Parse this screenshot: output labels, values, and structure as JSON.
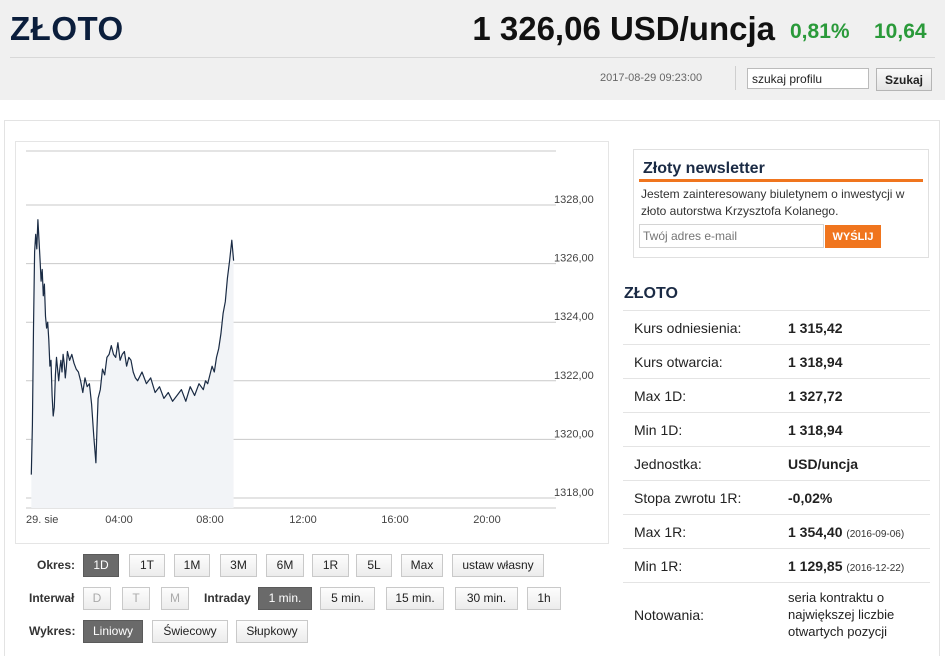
{
  "header": {
    "title": "ZŁOTO",
    "price": "1 326,06 USD/uncja",
    "change_pct": "0,81%",
    "change_abs": "10,64",
    "timestamp": "2017-08-29 09:23:00",
    "search_value": "szukaj profilu",
    "search_button": "Szukaj",
    "accent_color": "#2a9a3a"
  },
  "chart_data": {
    "type": "line",
    "title": "",
    "xlabel": "",
    "ylabel": "",
    "x_ticks": [
      "29. sie",
      "04:00",
      "08:00",
      "12:00",
      "16:00",
      "20:00"
    ],
    "y_ticks": [
      "1328,00",
      "1326,00",
      "1324,00",
      "1322,00",
      "1320,00",
      "1318,00"
    ],
    "ylim": [
      1318,
      1328
    ],
    "x_hours": [
      0.15,
      0.2,
      0.25,
      0.3,
      0.35,
      0.4,
      0.45,
      0.5,
      0.55,
      0.6,
      0.65,
      0.7,
      0.75,
      0.8,
      0.85,
      0.9,
      0.95,
      1.0,
      1.05,
      1.1,
      1.15,
      1.2,
      1.25,
      1.3,
      1.35,
      1.4,
      1.45,
      1.5,
      1.55,
      1.6,
      1.65,
      1.7,
      1.75,
      1.8,
      1.9,
      2.0,
      2.1,
      2.2,
      2.3,
      2.4,
      2.5,
      2.6,
      2.7,
      2.8,
      2.9,
      3.0,
      3.1,
      3.15,
      3.2,
      3.3,
      3.4,
      3.5,
      3.6,
      3.7,
      3.8,
      3.9,
      4.0,
      4.1,
      4.2,
      4.3,
      4.4,
      4.5,
      4.6,
      4.7,
      4.8,
      4.9,
      5.0,
      5.2,
      5.4,
      5.6,
      5.8,
      6.0,
      6.2,
      6.4,
      6.6,
      6.8,
      7.0,
      7.2,
      7.4,
      7.6,
      7.8,
      8.0,
      8.1,
      8.2,
      8.3,
      8.4,
      8.5,
      8.6,
      8.7,
      8.8,
      8.9,
      9.0,
      9.1,
      9.2,
      9.3,
      9.38
    ],
    "values": [
      1318.8,
      1320.5,
      1323.8,
      1326.4,
      1327.0,
      1326.5,
      1327.5,
      1326.8,
      1326.1,
      1325.4,
      1325.8,
      1324.9,
      1325.3,
      1324.2,
      1323.8,
      1324.0,
      1323.4,
      1322.5,
      1322.7,
      1321.5,
      1320.8,
      1321.1,
      1322.2,
      1322.8,
      1322.4,
      1322.0,
      1322.4,
      1322.7,
      1322.3,
      1322.9,
      1322.6,
      1322.1,
      1322.5,
      1323.0,
      1322.7,
      1322.9,
      1322.6,
      1322.4,
      1322.3,
      1322.0,
      1321.6,
      1322.1,
      1321.8,
      1321.9,
      1321.2,
      1320.1,
      1319.2,
      1320.4,
      1321.4,
      1321.7,
      1322.4,
      1322.2,
      1322.8,
      1322.9,
      1323.2,
      1322.9,
      1322.8,
      1323.3,
      1322.7,
      1322.9,
      1323.0,
      1322.5,
      1322.8,
      1322.7,
      1322.3,
      1322.1,
      1322.0,
      1322.3,
      1321.9,
      1322.1,
      1321.6,
      1321.8,
      1321.4,
      1321.6,
      1321.3,
      1321.5,
      1321.7,
      1321.3,
      1321.8,
      1321.5,
      1321.9,
      1321.7,
      1322.0,
      1321.9,
      1322.2,
      1322.5,
      1322.3,
      1322.8,
      1323.1,
      1323.6,
      1324.3,
      1324.7,
      1325.5,
      1326.1,
      1326.8,
      1326.1
    ],
    "line_color": "#1a2b44",
    "area_color": "#f2f4f7",
    "grid": true
  },
  "controls": {
    "okres_label": "Okres:",
    "okres": [
      {
        "label": "1D",
        "active": true
      },
      {
        "label": "1T",
        "active": false
      },
      {
        "label": "1M",
        "active": false
      },
      {
        "label": "3M",
        "active": false
      },
      {
        "label": "6M",
        "active": false
      },
      {
        "label": "1R",
        "active": false
      },
      {
        "label": "5L",
        "active": false
      },
      {
        "label": "Max",
        "active": false
      },
      {
        "label": "ustaw własny",
        "active": false
      }
    ],
    "interwal_label": "Interwał",
    "interwal": [
      {
        "label": "D",
        "disabled": true
      },
      {
        "label": "T",
        "disabled": true
      },
      {
        "label": "M",
        "disabled": true
      }
    ],
    "intraday_label": "Intraday",
    "intraday": [
      {
        "label": "1 min.",
        "active": true
      },
      {
        "label": "5 min.",
        "active": false
      },
      {
        "label": "15 min.",
        "active": false
      },
      {
        "label": "30 min.",
        "active": false
      },
      {
        "label": "1h",
        "active": false
      }
    ],
    "wykres_label": "Wykres:",
    "wykres": [
      {
        "label": "Liniowy",
        "active": true
      },
      {
        "label": "Świecowy",
        "active": false
      },
      {
        "label": "Słupkowy",
        "active": false
      }
    ]
  },
  "newsletter": {
    "title": "Złoty newsletter",
    "text": "Jestem zainteresowany biuletynem o inwestycji w złoto autorstwa Krzysztofa Kolanego.",
    "email_placeholder": "Twój adres e-mail",
    "button": "WYŚLIJ",
    "accent_color": "#f0751e"
  },
  "info": {
    "title": "ZŁOTO",
    "rows": [
      {
        "label": "Kurs odniesienia:",
        "value": "1 315,42",
        "date": ""
      },
      {
        "label": "Kurs otwarcia:",
        "value": "1 318,94",
        "date": ""
      },
      {
        "label": "Max 1D:",
        "value": "1 327,72",
        "date": ""
      },
      {
        "label": "Min 1D:",
        "value": "1 318,94",
        "date": ""
      },
      {
        "label": "Jednostka:",
        "value": "USD/uncja",
        "date": ""
      },
      {
        "label": "Stopa zwrotu 1R:",
        "value": "-0,02%",
        "date": ""
      },
      {
        "label": "Max 1R:",
        "value": "1 354,40",
        "date": "(2016-09-06)"
      },
      {
        "label": "Min 1R:",
        "value": "1 129,85",
        "date": "(2016-12-22)"
      },
      {
        "label": "Notowania:",
        "value": "seria kontraktu o największej liczbie otwartych pozycji",
        "date": ""
      }
    ]
  }
}
